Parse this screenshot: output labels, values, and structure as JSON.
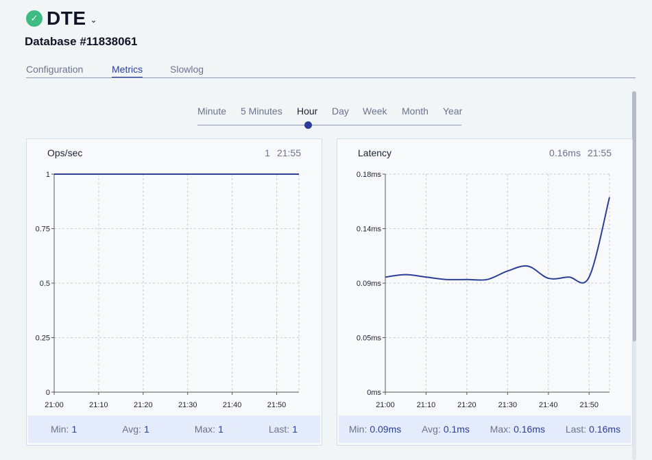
{
  "header": {
    "status_icon": "check-icon",
    "status_color": "#3dbb83",
    "app_name": "DTE",
    "database_label": "Database #11838061"
  },
  "tabs": [
    {
      "label": "Configuration",
      "active": false
    },
    {
      "label": "Metrics",
      "active": true
    },
    {
      "label": "Slowlog",
      "active": false
    }
  ],
  "time_range": {
    "options": [
      "Minute",
      "5 Minutes",
      "Hour",
      "Day",
      "Week",
      "Month",
      "Year"
    ],
    "selected": "Hour"
  },
  "panels": [
    {
      "title": "Ops/sec",
      "latest_value": "1",
      "latest_time": "21:55",
      "stats": {
        "min_label": "Min:",
        "min": "1",
        "avg_label": "Avg:",
        "avg": "1",
        "max_label": "Max:",
        "max": "1",
        "last_label": "Last:",
        "last": "1"
      }
    },
    {
      "title": "Latency",
      "latest_value": "0.16ms",
      "latest_time": "21:55",
      "stats": {
        "min_label": "Min:",
        "min": "0.09ms",
        "avg_label": "Avg:",
        "avg": "0.1ms",
        "max_label": "Max:",
        "max": "0.16ms",
        "last_label": "Last:",
        "last": "0.16ms"
      }
    }
  ],
  "chart_data": [
    {
      "type": "line",
      "title": "Ops/sec",
      "xlabel": "",
      "ylabel": "",
      "x_ticks": [
        "21:00",
        "21:10",
        "21:20",
        "21:30",
        "21:40",
        "21:50"
      ],
      "y_ticks": [
        "0",
        "0.25",
        "0.5",
        "0.75",
        "1"
      ],
      "ylim": [
        0,
        1
      ],
      "grid": true,
      "line_color": "#2a3d99",
      "series": [
        {
          "x": [
            0,
            5,
            10,
            15,
            20,
            25,
            30,
            35,
            40,
            45,
            50,
            55
          ],
          "values": [
            1,
            1,
            1,
            1,
            1,
            1,
            1,
            1,
            1,
            1,
            1,
            1
          ]
        }
      ]
    },
    {
      "type": "line",
      "title": "Latency",
      "xlabel": "",
      "ylabel": "",
      "x_ticks": [
        "21:00",
        "21:10",
        "21:20",
        "21:30",
        "21:40",
        "21:50"
      ],
      "y_ticks": [
        "0ms",
        "0.05ms",
        "0.09ms",
        "0.14ms",
        "0.18ms"
      ],
      "ylim": [
        0,
        0.18
      ],
      "grid": true,
      "line_color": "#2a3d99",
      "series": [
        {
          "x": [
            0,
            5,
            10,
            15,
            20,
            25,
            30,
            35,
            40,
            45,
            50,
            55
          ],
          "values": [
            0.095,
            0.097,
            0.095,
            0.093,
            0.093,
            0.093,
            0.1,
            0.104,
            0.094,
            0.095,
            0.095,
            0.161
          ]
        }
      ]
    }
  ]
}
